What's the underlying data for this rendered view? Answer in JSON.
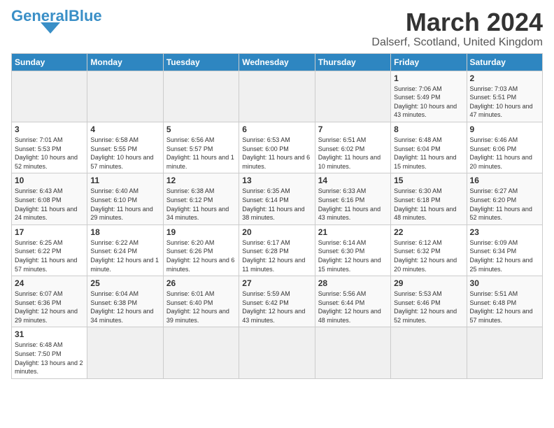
{
  "logo": {
    "text_general": "General",
    "text_blue": "Blue"
  },
  "title": {
    "month_year": "March 2024",
    "location": "Dalserf, Scotland, United Kingdom"
  },
  "days_of_week": [
    "Sunday",
    "Monday",
    "Tuesday",
    "Wednesday",
    "Thursday",
    "Friday",
    "Saturday"
  ],
  "weeks": [
    [
      {
        "day": "",
        "info": ""
      },
      {
        "day": "",
        "info": ""
      },
      {
        "day": "",
        "info": ""
      },
      {
        "day": "",
        "info": ""
      },
      {
        "day": "",
        "info": ""
      },
      {
        "day": "1",
        "info": "Sunrise: 7:06 AM\nSunset: 5:49 PM\nDaylight: 10 hours and 43 minutes."
      },
      {
        "day": "2",
        "info": "Sunrise: 7:03 AM\nSunset: 5:51 PM\nDaylight: 10 hours and 47 minutes."
      }
    ],
    [
      {
        "day": "3",
        "info": "Sunrise: 7:01 AM\nSunset: 5:53 PM\nDaylight: 10 hours and 52 minutes."
      },
      {
        "day": "4",
        "info": "Sunrise: 6:58 AM\nSunset: 5:55 PM\nDaylight: 10 hours and 57 minutes."
      },
      {
        "day": "5",
        "info": "Sunrise: 6:56 AM\nSunset: 5:57 PM\nDaylight: 11 hours and 1 minute."
      },
      {
        "day": "6",
        "info": "Sunrise: 6:53 AM\nSunset: 6:00 PM\nDaylight: 11 hours and 6 minutes."
      },
      {
        "day": "7",
        "info": "Sunrise: 6:51 AM\nSunset: 6:02 PM\nDaylight: 11 hours and 10 minutes."
      },
      {
        "day": "8",
        "info": "Sunrise: 6:48 AM\nSunset: 6:04 PM\nDaylight: 11 hours and 15 minutes."
      },
      {
        "day": "9",
        "info": "Sunrise: 6:46 AM\nSunset: 6:06 PM\nDaylight: 11 hours and 20 minutes."
      }
    ],
    [
      {
        "day": "10",
        "info": "Sunrise: 6:43 AM\nSunset: 6:08 PM\nDaylight: 11 hours and 24 minutes."
      },
      {
        "day": "11",
        "info": "Sunrise: 6:40 AM\nSunset: 6:10 PM\nDaylight: 11 hours and 29 minutes."
      },
      {
        "day": "12",
        "info": "Sunrise: 6:38 AM\nSunset: 6:12 PM\nDaylight: 11 hours and 34 minutes."
      },
      {
        "day": "13",
        "info": "Sunrise: 6:35 AM\nSunset: 6:14 PM\nDaylight: 11 hours and 38 minutes."
      },
      {
        "day": "14",
        "info": "Sunrise: 6:33 AM\nSunset: 6:16 PM\nDaylight: 11 hours and 43 minutes."
      },
      {
        "day": "15",
        "info": "Sunrise: 6:30 AM\nSunset: 6:18 PM\nDaylight: 11 hours and 48 minutes."
      },
      {
        "day": "16",
        "info": "Sunrise: 6:27 AM\nSunset: 6:20 PM\nDaylight: 11 hours and 52 minutes."
      }
    ],
    [
      {
        "day": "17",
        "info": "Sunrise: 6:25 AM\nSunset: 6:22 PM\nDaylight: 11 hours and 57 minutes."
      },
      {
        "day": "18",
        "info": "Sunrise: 6:22 AM\nSunset: 6:24 PM\nDaylight: 12 hours and 1 minute."
      },
      {
        "day": "19",
        "info": "Sunrise: 6:20 AM\nSunset: 6:26 PM\nDaylight: 12 hours and 6 minutes."
      },
      {
        "day": "20",
        "info": "Sunrise: 6:17 AM\nSunset: 6:28 PM\nDaylight: 12 hours and 11 minutes."
      },
      {
        "day": "21",
        "info": "Sunrise: 6:14 AM\nSunset: 6:30 PM\nDaylight: 12 hours and 15 minutes."
      },
      {
        "day": "22",
        "info": "Sunrise: 6:12 AM\nSunset: 6:32 PM\nDaylight: 12 hours and 20 minutes."
      },
      {
        "day": "23",
        "info": "Sunrise: 6:09 AM\nSunset: 6:34 PM\nDaylight: 12 hours and 25 minutes."
      }
    ],
    [
      {
        "day": "24",
        "info": "Sunrise: 6:07 AM\nSunset: 6:36 PM\nDaylight: 12 hours and 29 minutes."
      },
      {
        "day": "25",
        "info": "Sunrise: 6:04 AM\nSunset: 6:38 PM\nDaylight: 12 hours and 34 minutes."
      },
      {
        "day": "26",
        "info": "Sunrise: 6:01 AM\nSunset: 6:40 PM\nDaylight: 12 hours and 39 minutes."
      },
      {
        "day": "27",
        "info": "Sunrise: 5:59 AM\nSunset: 6:42 PM\nDaylight: 12 hours and 43 minutes."
      },
      {
        "day": "28",
        "info": "Sunrise: 5:56 AM\nSunset: 6:44 PM\nDaylight: 12 hours and 48 minutes."
      },
      {
        "day": "29",
        "info": "Sunrise: 5:53 AM\nSunset: 6:46 PM\nDaylight: 12 hours and 52 minutes."
      },
      {
        "day": "30",
        "info": "Sunrise: 5:51 AM\nSunset: 6:48 PM\nDaylight: 12 hours and 57 minutes."
      }
    ],
    [
      {
        "day": "31",
        "info": "Sunrise: 6:48 AM\nSunset: 7:50 PM\nDaylight: 13 hours and 2 minutes."
      },
      {
        "day": "",
        "info": ""
      },
      {
        "day": "",
        "info": ""
      },
      {
        "day": "",
        "info": ""
      },
      {
        "day": "",
        "info": ""
      },
      {
        "day": "",
        "info": ""
      },
      {
        "day": "",
        "info": ""
      }
    ]
  ]
}
